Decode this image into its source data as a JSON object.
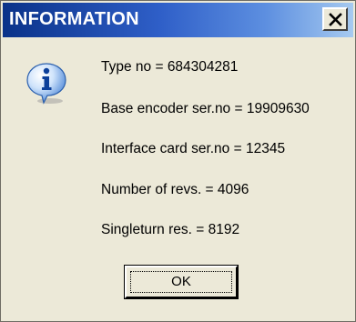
{
  "dialog": {
    "title": "INFORMATION",
    "icon": "info-icon",
    "lines": [
      "Type no = 684304281",
      "Base encoder ser.no = 19909630",
      "Interface card ser.no = 12345",
      "Number of revs. = 4096",
      "Singleturn res. = 8192"
    ],
    "ok_label": "OK"
  },
  "colors": {
    "titlebar_start": "#0a3289",
    "titlebar_end": "#a6caf0",
    "window_bg": "#ece9d8"
  }
}
